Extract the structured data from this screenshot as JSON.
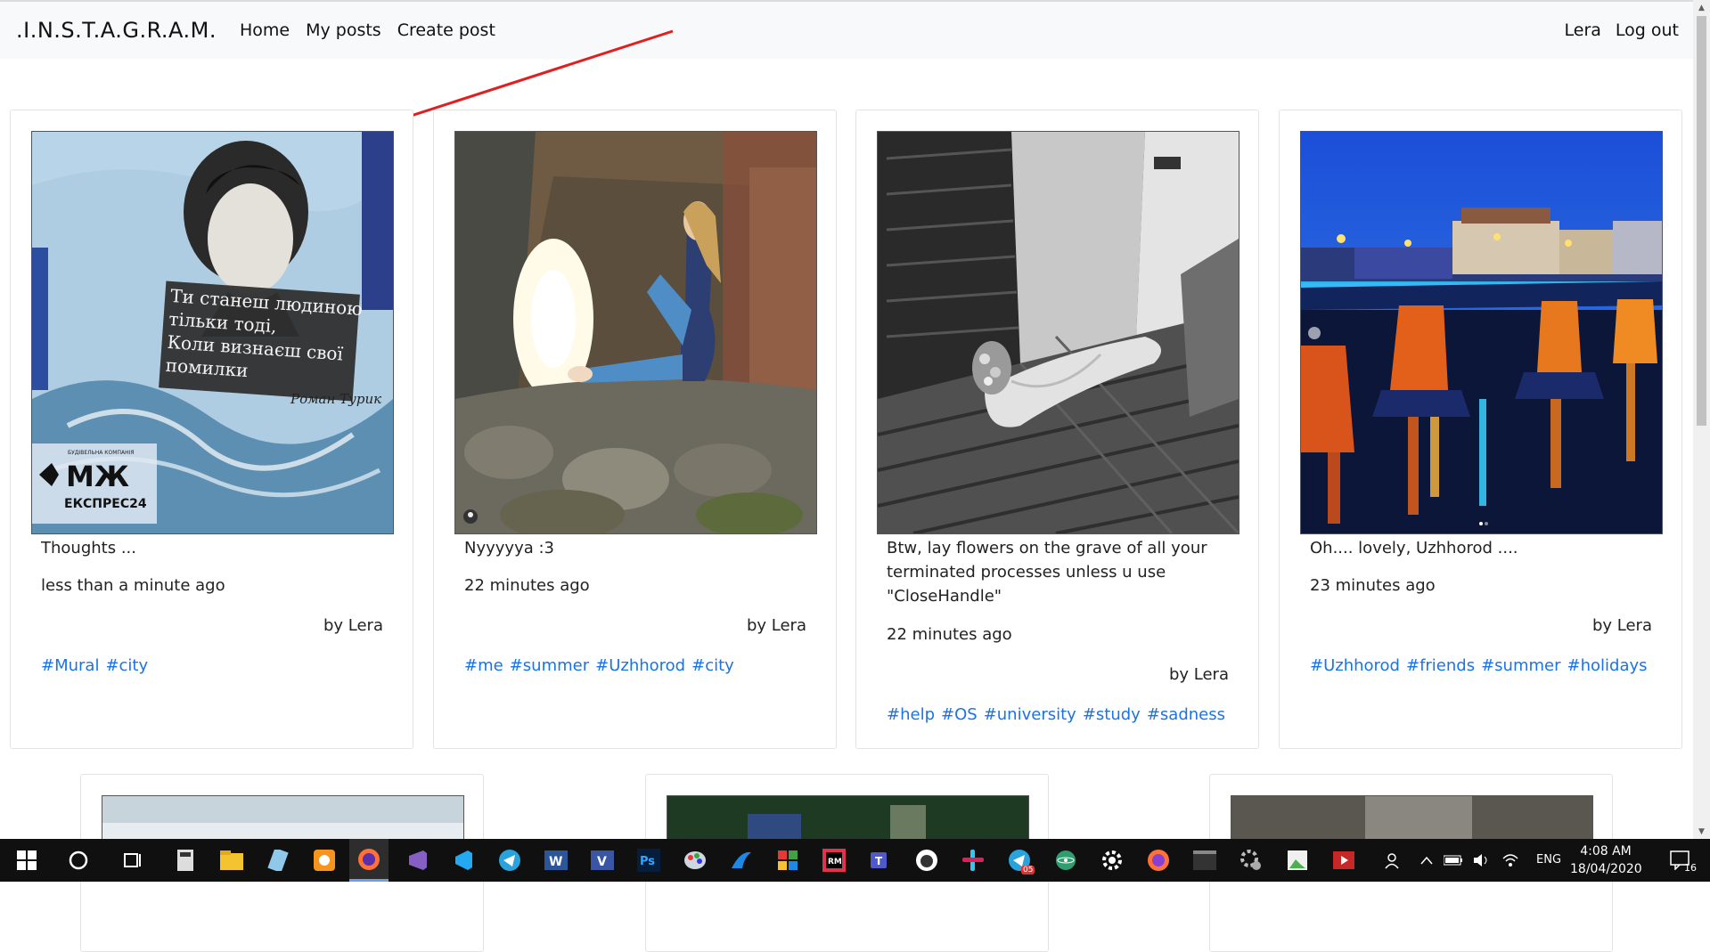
{
  "navbar": {
    "brand": ".I.N.S.T.A.G.R.A.M.",
    "links": [
      "Home",
      "My posts",
      "Create post"
    ],
    "user": "Lera",
    "logout": "Log out"
  },
  "posts": [
    {
      "caption": "Thoughts ...",
      "time": "less than a minute ago",
      "author": "by Lera",
      "tags": [
        "#Mural",
        "#city"
      ],
      "mural_lines": [
        "Ти станеш людиною",
        "тільки тоді,",
        "Коли визнаєш свої",
        "помилки"
      ],
      "mural_signature": "Роман Турик",
      "mural_logo_top": "БУДІВЕЛЬНА КОМПАНІЯ",
      "mural_logo_main": "МЖ",
      "mural_logo_bottom": "ЕКСПРЕС24"
    },
    {
      "caption": "Nyyyyya :3",
      "time": "22 minutes ago",
      "author": "by Lera",
      "tags": [
        "#me",
        "#summer",
        "#Uzhhorod",
        "#city"
      ]
    },
    {
      "caption": "Btw, lay flowers on the grave of all your terminated processes unless u use \"CloseHandle\"",
      "time": "22 minutes ago",
      "author": "by Lera",
      "tags": [
        "#help",
        "#OS",
        "#university",
        "#study",
        "#sadness"
      ]
    },
    {
      "caption": "Oh.... lovely, Uzhhorod ....",
      "time": "23 minutes ago",
      "author": "by Lera",
      "tags": [
        "#Uzhhorod",
        "#friends",
        "#summer",
        "#holidays"
      ]
    }
  ],
  "taskbar": {
    "language": "ENG",
    "time": "4:08 AM",
    "date": "18/04/2020",
    "notification_count": "16",
    "badge_count": "05",
    "icons": [
      "windows-start-icon",
      "cortana-icon",
      "task-view-icon",
      "calculator-icon",
      "file-explorer-icon",
      "notepad-icon",
      "scratch-app-icon",
      "firefox-icon",
      "visual-studio-icon",
      "vscode-icon",
      "telegram-icon",
      "word-icon",
      "visio-icon",
      "photoshop-icon",
      "paint-icon",
      "shark-app-icon",
      "palette-app-icon",
      "rubymine-icon",
      "teams-icon",
      "tor-icon",
      "slack-icon",
      "telegram-badge-icon",
      "atom-icon",
      "settings-icon",
      "firefox-alt-icon",
      "terminal-icon",
      "services-icon",
      "photo-app-icon",
      "video-app-icon"
    ]
  },
  "colors": {
    "accent": "#1a73e8",
    "navbar_bg": "#f8f9fa",
    "arrow": "#e02020"
  }
}
